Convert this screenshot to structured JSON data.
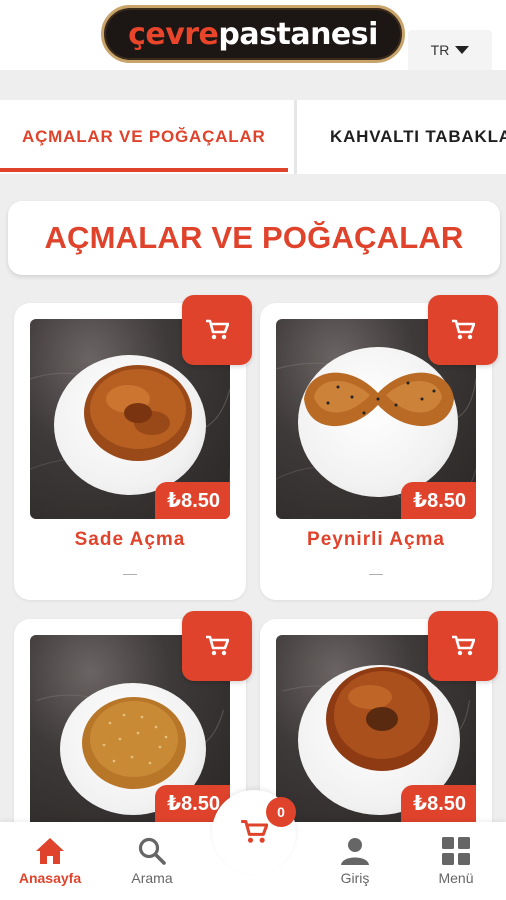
{
  "header": {
    "logo_part1": "çevre",
    "logo_part2": "pastanesi",
    "language": "TR"
  },
  "tabs": [
    {
      "label": "AÇMALAR VE POĞAÇALAR",
      "active": true
    },
    {
      "label": "KAHVALTI TABAKLARI",
      "active": false
    }
  ],
  "section": {
    "title": "AÇMALAR VE POĞAÇALAR"
  },
  "products": [
    {
      "name": "Sade Açma",
      "price": "₺8.50",
      "description": "—"
    },
    {
      "name": "Peynirli Açma",
      "price": "₺8.50",
      "description": "—"
    },
    {
      "name": "",
      "price": "₺8.50",
      "description": ""
    },
    {
      "name": "",
      "price": "₺8.50",
      "description": ""
    }
  ],
  "bottom_nav": {
    "home": "Anasayfa",
    "search": "Arama",
    "cart_count": "0",
    "login": "Giriş",
    "menu": "Menü"
  },
  "colors": {
    "accent": "#e0432c",
    "background": "#eeeeee"
  },
  "icons": [
    "cart-icon",
    "home-icon",
    "search-icon",
    "user-icon",
    "grid-menu-icon",
    "caret-down-icon"
  ]
}
